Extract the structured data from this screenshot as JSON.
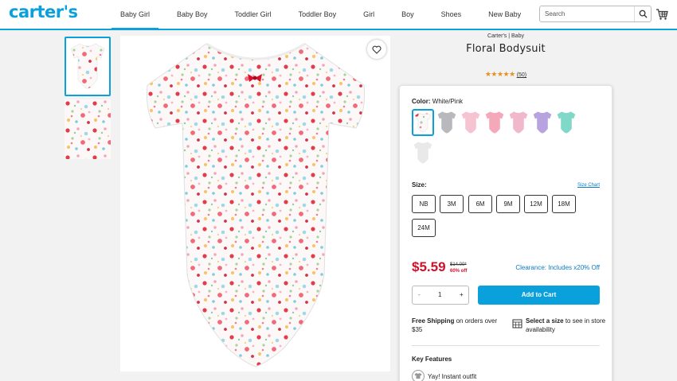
{
  "header": {
    "logo": "carter's",
    "nav": [
      "Baby Girl",
      "Baby Boy",
      "Toddler Girl",
      "Toddler Boy",
      "Girl",
      "Boy",
      "Shoes",
      "New Baby"
    ],
    "search_placeholder": "Search"
  },
  "product": {
    "brand": "Carter's | Baby",
    "title": "Floral Bodysuit",
    "stars": "★★★★★",
    "reviews": "(50)",
    "rating": 5
  },
  "panel": {
    "color_label": "Color:",
    "color_value": "White/Pink",
    "size_label": "Size:",
    "size_chart": "Size Chart",
    "sizes": [
      "NB",
      "3M",
      "6M",
      "9M",
      "12M",
      "18M",
      "24M"
    ],
    "price": "$5.59",
    "original_price": "$14.00*",
    "percent_off": "60% off",
    "clearance": "Clearance: Includes x20% Off",
    "qty_minus": "-",
    "qty_value": "1",
    "qty_plus": "+",
    "add_to_cart": "Add to Cart",
    "shipping_bold": "Free Shipping",
    "shipping_rest": " on orders over $35",
    "store_bold": "Select a size",
    "store_rest": " to see in store availability",
    "key_features": "Key Features",
    "feature_1": "Yay! Instant outfit"
  },
  "colors": {
    "accent": "#0aa0dc",
    "price_red": "#d0112b",
    "link_blue": "#0a7bc4",
    "star": "#e8901c",
    "swatches": [
      "#f3e4ea",
      "#b9b9bd",
      "#f6c3d2",
      "#f4a9bb",
      "#f1b8cb",
      "#b7a3e0",
      "#7fd8c8",
      "#e9e9ea"
    ]
  }
}
